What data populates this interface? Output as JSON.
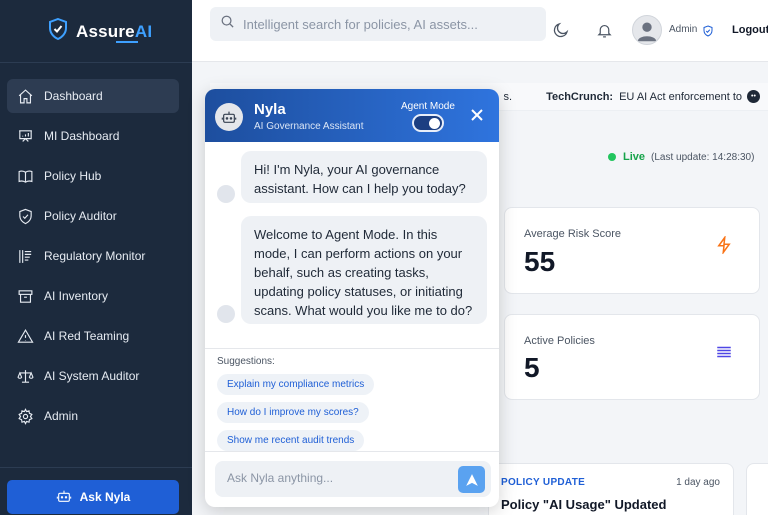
{
  "app": {
    "name_prefix": "Assure",
    "name_suffix": "AI",
    "accent": "#3ea0ff"
  },
  "sidebar": {
    "items": [
      {
        "label": "Dashboard",
        "icon": "home-icon",
        "active": true
      },
      {
        "label": "MI Dashboard",
        "icon": "presentation-icon"
      },
      {
        "label": "Policy Hub",
        "icon": "book-icon"
      },
      {
        "label": "Policy Auditor",
        "icon": "shield-check-icon"
      },
      {
        "label": "Regulatory Monitor",
        "icon": "document-lines-icon"
      },
      {
        "label": "AI Inventory",
        "icon": "archive-icon"
      },
      {
        "label": "AI Red Teaming",
        "icon": "warning-icon"
      },
      {
        "label": "AI System Auditor",
        "icon": "scale-icon"
      },
      {
        "label": "Admin",
        "icon": "gear-icon"
      }
    ],
    "ask_button": "Ask Nyla"
  },
  "header": {
    "search_placeholder": "Intelligent search for policies, AI assets...",
    "user_label": "Admin",
    "logout_label": "Logout"
  },
  "ticker": {
    "prefix": "s.",
    "source": "TechCrunch:",
    "headline": "EU AI Act enforcement to",
    "more": "••"
  },
  "status": {
    "live_label": "Live",
    "last_update": "(Last update: 14:28:30)"
  },
  "cards": {
    "risk": {
      "title": "Average Risk Score",
      "value": "55",
      "icon": "bolt-icon",
      "icon_color": "#f97316"
    },
    "policies": {
      "title": "Active Policies",
      "value": "5",
      "icon": "list-icon",
      "icon_color": "#4f46e5"
    },
    "update": {
      "tag": "POLICY UPDATE",
      "time": "1 day ago",
      "title": "Policy \"AI Usage\" Updated"
    }
  },
  "chat": {
    "name": "Nyla",
    "subtitle": "AI Governance Assistant",
    "mode_label": "Agent Mode",
    "mode_on": true,
    "messages": [
      "Hi! I'm Nyla, your AI governance assistant. How can I help you today?",
      "Welcome to Agent Mode. In this mode, I can perform actions on your behalf, such as creating tasks, updating policy statuses, or initiating scans. What would you like me to do?"
    ],
    "suggestions_label": "Suggestions:",
    "suggestions": [
      "Explain my compliance metrics",
      "How do I improve my scores?",
      "Show me recent audit trends"
    ],
    "input_placeholder": "Ask Nyla anything..."
  }
}
